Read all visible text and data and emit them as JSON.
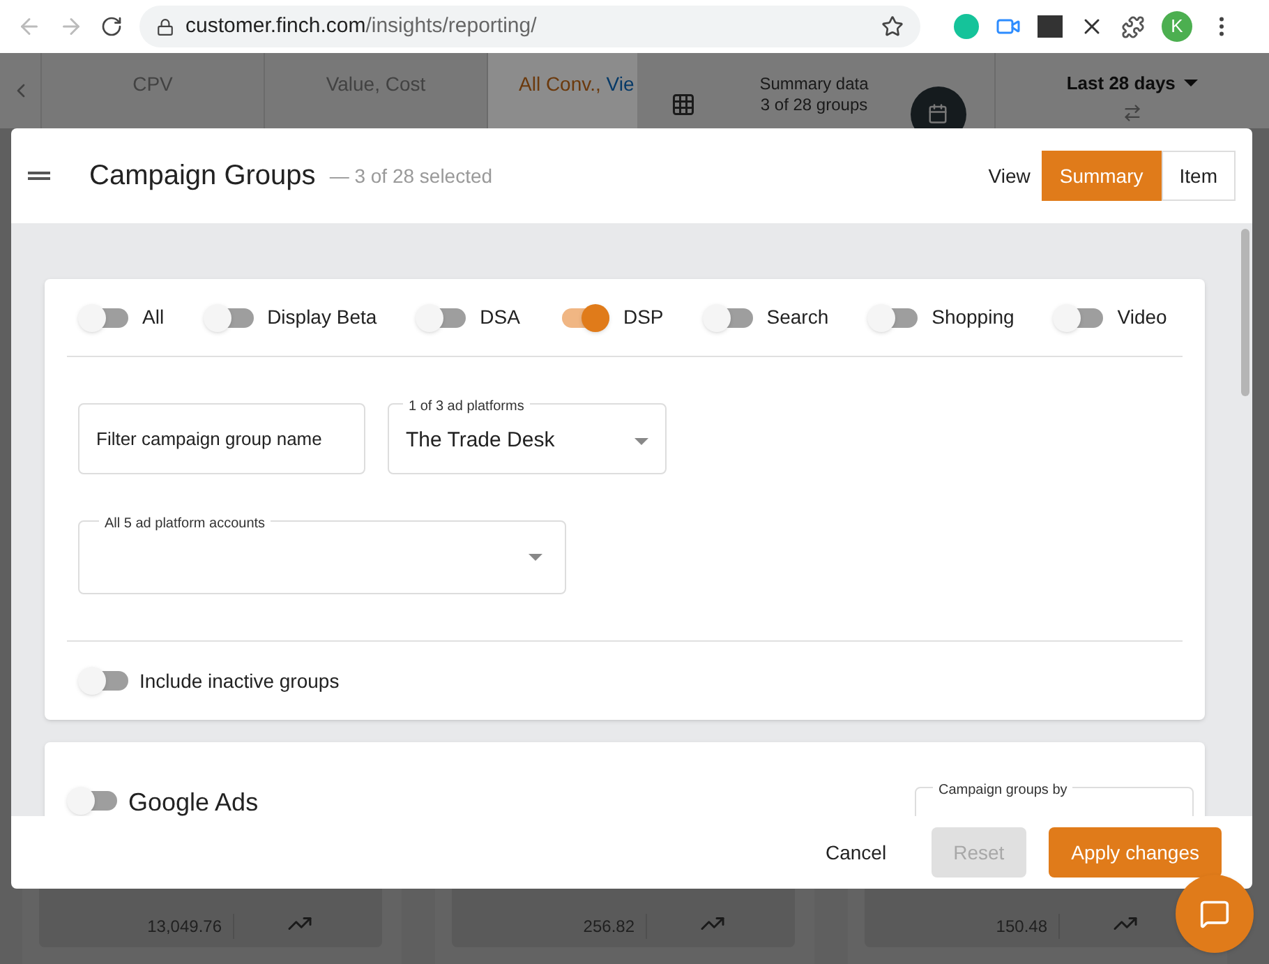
{
  "browser": {
    "url_host": "customer.finch.com",
    "url_path": "/insights/reporting/",
    "avatar": "K"
  },
  "background": {
    "tabs": [
      {
        "label": "CPV",
        "selected": false
      },
      {
        "label": "Value, Cost",
        "selected": false
      },
      {
        "label": "All Conv.,",
        "link": "Vie",
        "selected": true
      }
    ],
    "summary": {
      "title": "Summary data",
      "count": "3 of 28 groups"
    },
    "date_range": "Last 28 days",
    "cards": [
      {
        "sub": "13,049.76"
      },
      {
        "sub": "256.82"
      },
      {
        "sub": "150.48"
      }
    ]
  },
  "modal": {
    "title": "Campaign Groups",
    "subtitle": "— 3 of 28 selected",
    "view_label": "View",
    "view_options": [
      {
        "label": "Summary",
        "selected": true
      },
      {
        "label": "Item",
        "selected": false
      }
    ],
    "channel_toggles": [
      {
        "label": "All",
        "on": false
      },
      {
        "label": "Display Beta",
        "on": false
      },
      {
        "label": "DSA",
        "on": false
      },
      {
        "label": "DSP",
        "on": true
      },
      {
        "label": "Search",
        "on": false
      },
      {
        "label": "Shopping",
        "on": false
      },
      {
        "label": "Video",
        "on": false
      }
    ],
    "name_filter": {
      "placeholder": "Filter campaign group name"
    },
    "platform_select": {
      "label": "1 of 3 ad platforms",
      "value": "The Trade Desk"
    },
    "accounts_select": {
      "label": "All 5 ad platform accounts"
    },
    "inactive_toggle": {
      "label": "Include inactive groups",
      "on": false
    },
    "section": {
      "title": "Google Ads",
      "on": false,
      "select_label": "Campaign groups by"
    },
    "buttons": [
      {
        "label": "Cancel",
        "kind": "text",
        "disabled": false
      },
      {
        "label": "Reset",
        "kind": "filled",
        "disabled": true
      },
      {
        "label": "Apply changes",
        "kind": "filled",
        "disabled": false
      }
    ]
  }
}
